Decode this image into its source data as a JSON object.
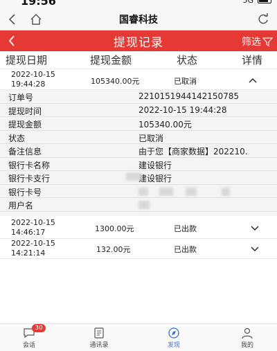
{
  "status_bar": {
    "time": "19:56",
    "network": "5G"
  },
  "browser": {
    "title": "国睿科技"
  },
  "header": {
    "title": "提现记录",
    "filter_label": "筛选"
  },
  "columns": [
    "提现日期",
    "提现金额",
    "状态",
    "详情"
  ],
  "records": [
    {
      "date": "2022-10-15",
      "time": "19:44:28",
      "amount": "105340.00元",
      "status": "已取消"
    },
    {
      "date": "2022-10-15",
      "time": "14:46:17",
      "amount": "1300.00元",
      "status": "已出款"
    },
    {
      "date": "2022-10-15",
      "time": "14:21:14",
      "amount": "132.00元",
      "status": "已出款"
    }
  ],
  "details": [
    {
      "label": "订单号",
      "value": "2210151944142150785"
    },
    {
      "label": "提现时间",
      "value": "2022-10-15 19:44:28"
    },
    {
      "label": "提现金额",
      "value": "105340.00元"
    },
    {
      "label": "状态",
      "value": "已取消"
    },
    {
      "label": "备注信息",
      "value": "由于您【商家数据】202210."
    },
    {
      "label": "银行卡名称",
      "value": "建设银行"
    },
    {
      "label": "银行卡支行",
      "value": "建设银行"
    },
    {
      "label": "银行卡号",
      "value": ""
    },
    {
      "label": "用户名",
      "value": ""
    }
  ],
  "nav": {
    "items": [
      "会话",
      "通讯录",
      "发现",
      "我的"
    ],
    "badge": "30",
    "active_color": "#3b73c7"
  },
  "colors": {
    "header_red": "#e53935"
  }
}
